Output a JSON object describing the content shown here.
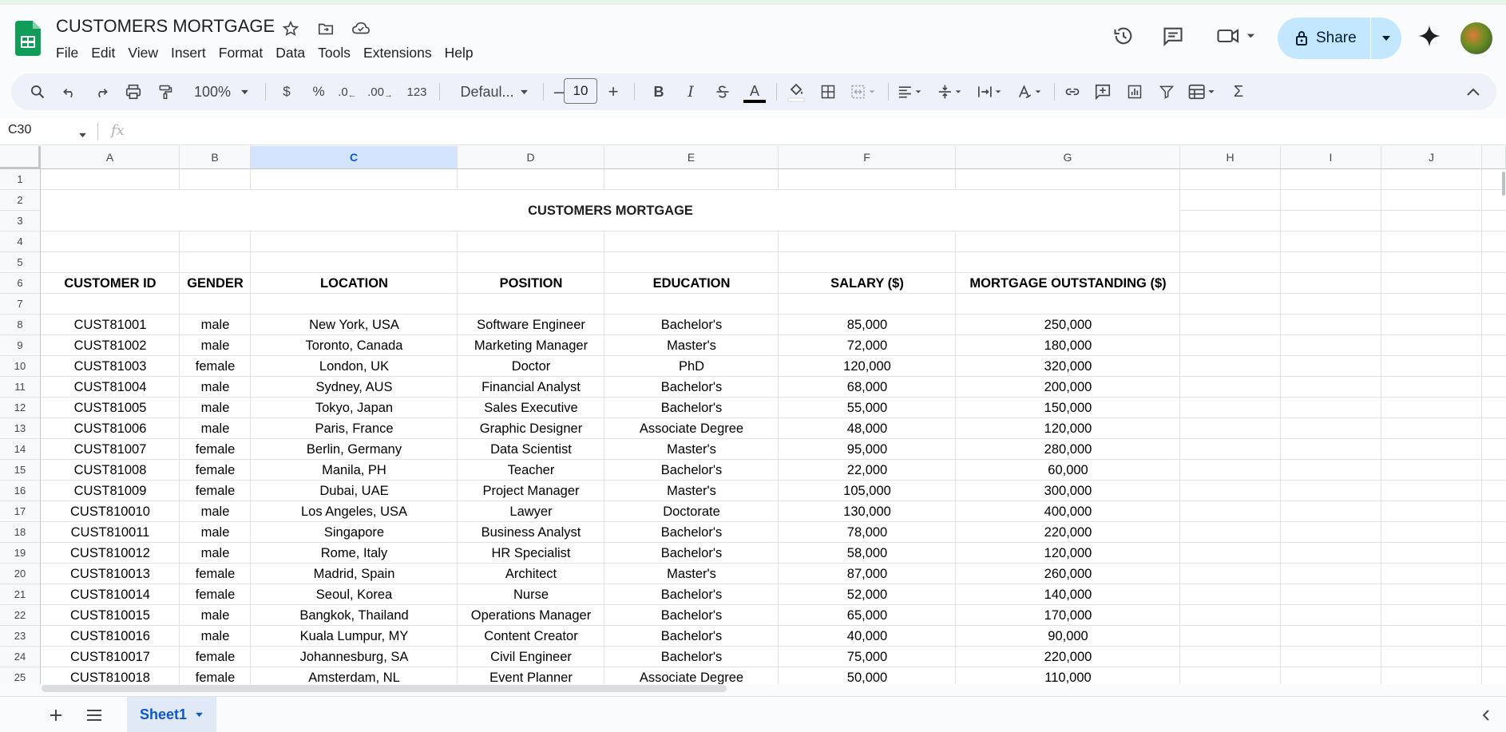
{
  "doc": {
    "title": "CUSTOMERS MORTGAGE"
  },
  "menu": [
    "File",
    "Edit",
    "View",
    "Insert",
    "Format",
    "Data",
    "Tools",
    "Extensions",
    "Help"
  ],
  "header": {
    "share_label": "Share"
  },
  "toolbar": {
    "zoom": "100%",
    "currency": "$",
    "percent": "%",
    "dec_decrease": ".0",
    "dec_increase": ".00",
    "number_format": "123",
    "font": "Defaul...",
    "font_size": "10",
    "minus": "–",
    "plus": "+",
    "bold": "B",
    "italic": "I",
    "text_color_label": "A",
    "sum_label": "Σ"
  },
  "formula_bar": {
    "name_box": "C30",
    "fx": "fx"
  },
  "sheet": {
    "columns": [
      "A",
      "B",
      "C",
      "D",
      "E",
      "F",
      "G",
      "H",
      "I",
      "J"
    ],
    "selected_column": "C",
    "rows": [
      "1",
      "2",
      "3",
      "4",
      "5",
      "6",
      "7",
      "8",
      "9",
      "10",
      "11",
      "12",
      "13",
      "14",
      "15",
      "16",
      "17",
      "18",
      "19",
      "20",
      "21",
      "22",
      "23",
      "24",
      "25"
    ],
    "title": "CUSTOMERS MORTGAGE",
    "headers": [
      "CUSTOMER ID",
      "GENDER",
      "LOCATION",
      "POSITION",
      "EDUCATION",
      "SALARY ($)",
      "MORTGAGE OUTSTANDING ($)"
    ],
    "data": [
      [
        "CUST81001",
        "male",
        "New York, USA",
        "Software Engineer",
        "Bachelor's",
        "85,000",
        "250,000"
      ],
      [
        "CUST81002",
        "male",
        "Toronto, Canada",
        "Marketing Manager",
        "Master's",
        "72,000",
        "180,000"
      ],
      [
        "CUST81003",
        "female",
        "London, UK",
        "Doctor",
        "PhD",
        "120,000",
        "320,000"
      ],
      [
        "CUST81004",
        "male",
        "Sydney, AUS",
        "Financial Analyst",
        "Bachelor's",
        "68,000",
        "200,000"
      ],
      [
        "CUST81005",
        "male",
        "Tokyo, Japan",
        "Sales Executive",
        "Bachelor's",
        "55,000",
        "150,000"
      ],
      [
        "CUST81006",
        "male",
        "Paris, France",
        "Graphic Designer",
        "Associate Degree",
        "48,000",
        "120,000"
      ],
      [
        "CUST81007",
        "female",
        "Berlin, Germany",
        "Data Scientist",
        "Master's",
        "95,000",
        "280,000"
      ],
      [
        "CUST81008",
        "female",
        "Manila, PH",
        "Teacher",
        "Bachelor's",
        "22,000",
        "60,000"
      ],
      [
        "CUST81009",
        "female",
        "Dubai, UAE",
        "Project Manager",
        "Master's",
        "105,000",
        "300,000"
      ],
      [
        "CUST810010",
        "male",
        "Los Angeles, USA",
        "Lawyer",
        "Doctorate",
        "130,000",
        "400,000"
      ],
      [
        "CUST810011",
        "male",
        "Singapore",
        "Business Analyst",
        "Bachelor's",
        "78,000",
        "220,000"
      ],
      [
        "CUST810012",
        "male",
        "Rome, Italy",
        "HR Specialist",
        "Bachelor's",
        "58,000",
        "120,000"
      ],
      [
        "CUST810013",
        "female",
        "Madrid, Spain",
        "Architect",
        "Master's",
        "87,000",
        "260,000"
      ],
      [
        "CUST810014",
        "female",
        "Seoul, Korea",
        "Nurse",
        "Bachelor's",
        "52,000",
        "140,000"
      ],
      [
        "CUST810015",
        "male",
        "Bangkok, Thailand",
        "Operations Manager",
        "Bachelor's",
        "65,000",
        "170,000"
      ],
      [
        "CUST810016",
        "male",
        "Kuala Lumpur, MY",
        "Content Creator",
        "Bachelor's",
        "40,000",
        "90,000"
      ],
      [
        "CUST810017",
        "female",
        "Johannesburg, SA",
        "Civil Engineer",
        "Bachelor's",
        "75,000",
        "220,000"
      ],
      [
        "CUST810018",
        "female",
        "Amsterdam, NL",
        "Event Planner",
        "Associate Degree",
        "50,000",
        "110,000"
      ]
    ]
  },
  "bottom": {
    "sheet_tab": "Sheet1"
  }
}
